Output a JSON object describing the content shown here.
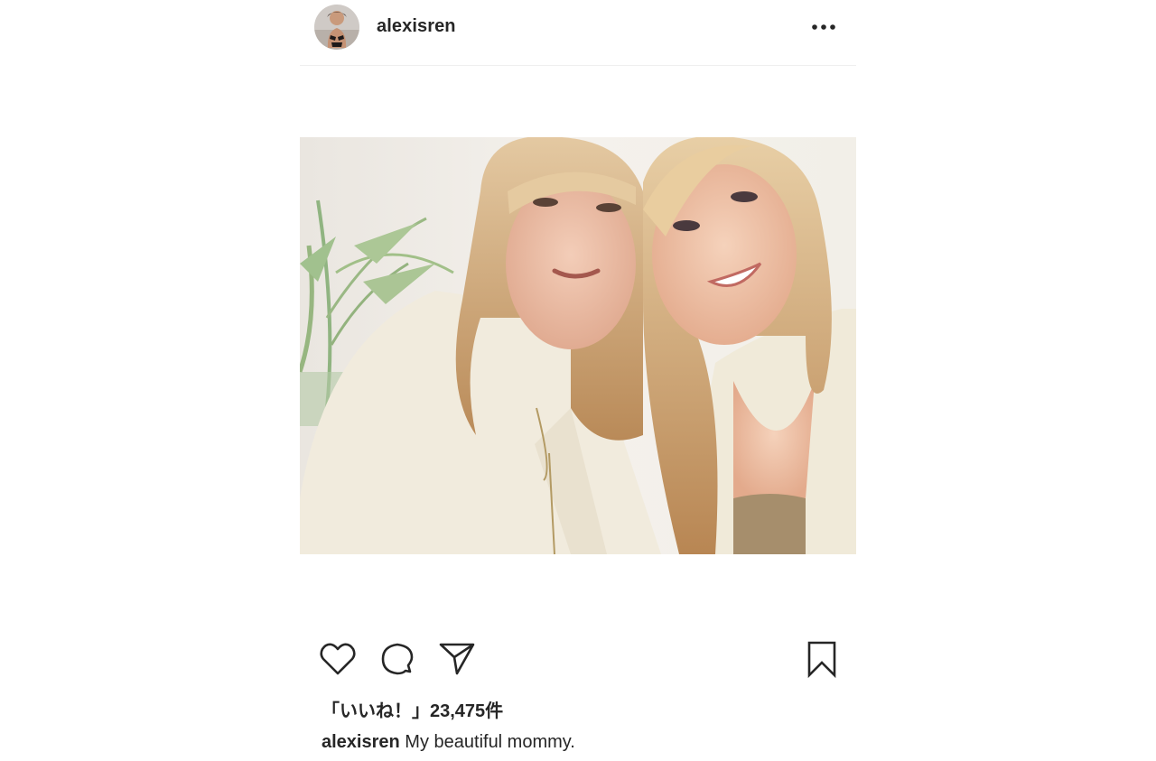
{
  "post": {
    "username": "alexisren",
    "likes_text": "「いいね！」23,475件",
    "caption": {
      "username": "alexisren",
      "text": "My beautiful mommy."
    }
  },
  "icons": {
    "more": "more-horizontal-icon",
    "like": "heart-icon",
    "comment": "comment-bubble-icon",
    "share": "paper-plane-icon",
    "save": "bookmark-icon"
  },
  "colors": {
    "text": "#262626",
    "divider": "#efefef",
    "background": "#ffffff"
  }
}
